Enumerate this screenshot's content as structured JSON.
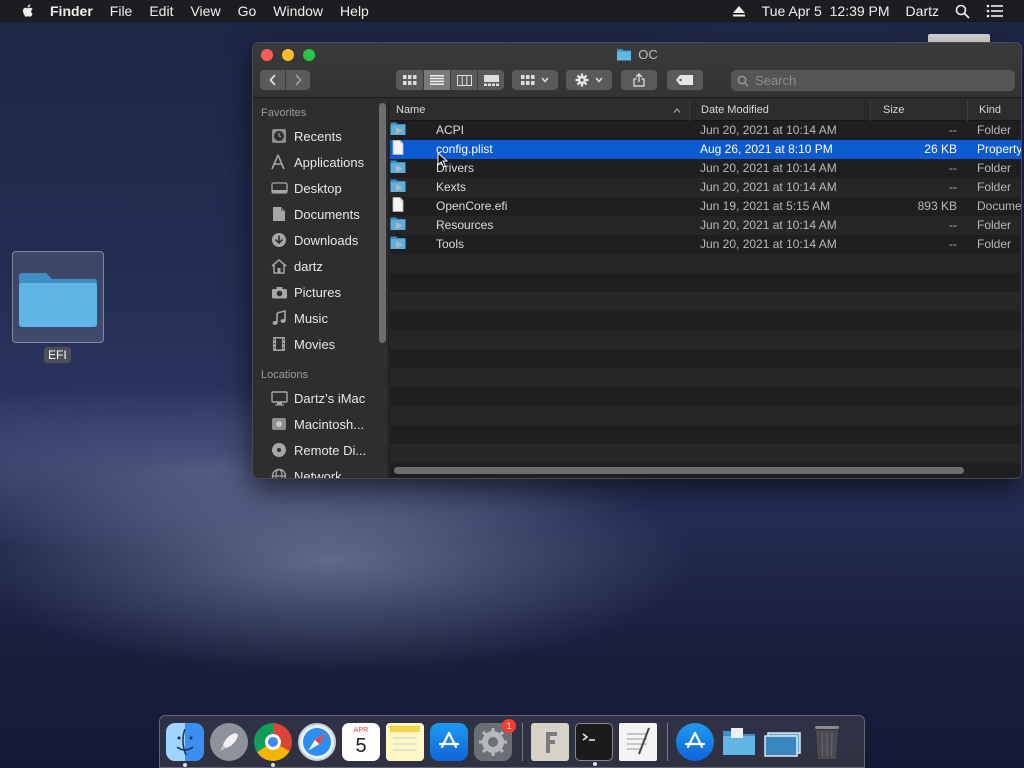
{
  "menubar": {
    "app_name": "Finder",
    "menus": [
      "File",
      "Edit",
      "View",
      "Go",
      "Window",
      "Help"
    ],
    "clock": "Tue Apr 5  12:39 PM",
    "user": "Dartz"
  },
  "desktop": {
    "efi_label": "EFI"
  },
  "window": {
    "title": "OC",
    "search_placeholder": "Search",
    "sidebar": {
      "favorites_heading": "Favorites",
      "favorites": [
        {
          "label": "Recents",
          "icon": "clock-icon"
        },
        {
          "label": "Applications",
          "icon": "applications-icon"
        },
        {
          "label": "Desktop",
          "icon": "desktop-icon"
        },
        {
          "label": "Documents",
          "icon": "documents-icon"
        },
        {
          "label": "Downloads",
          "icon": "downloads-icon"
        },
        {
          "label": "dartz",
          "icon": "home-icon"
        },
        {
          "label": "Pictures",
          "icon": "camera-icon"
        },
        {
          "label": "Music",
          "icon": "music-icon"
        },
        {
          "label": "Movies",
          "icon": "film-icon"
        }
      ],
      "locations_heading": "Locations",
      "locations": [
        {
          "label": "Dartz’s iMac",
          "icon": "imac-icon"
        },
        {
          "label": "Macintosh...",
          "icon": "disk-icon"
        },
        {
          "label": "Remote Di...",
          "icon": "remote-disc-icon"
        },
        {
          "label": "Network",
          "icon": "network-icon"
        }
      ]
    },
    "columns": {
      "name": "Name",
      "date": "Date Modified",
      "size": "Size",
      "kind": "Kind"
    },
    "files": [
      {
        "name": "ACPI",
        "date": "Jun 20, 2021 at 10:14 AM",
        "size": "--",
        "kind": "Folder",
        "type": "folder",
        "selected": false
      },
      {
        "name": "config.plist",
        "date": "Aug 26, 2021 at 8:10 PM",
        "size": "26 KB",
        "kind": "Property",
        "type": "file",
        "selected": true
      },
      {
        "name": "Drivers",
        "date": "Jun 20, 2021 at 10:14 AM",
        "size": "--",
        "kind": "Folder",
        "type": "folder",
        "selected": false
      },
      {
        "name": "Kexts",
        "date": "Jun 20, 2021 at 10:14 AM",
        "size": "--",
        "kind": "Folder",
        "type": "folder",
        "selected": false
      },
      {
        "name": "OpenCore.efi",
        "date": "Jun 19, 2021 at 5:15 AM",
        "size": "893 KB",
        "kind": "Docume",
        "type": "file",
        "selected": false
      },
      {
        "name": "Resources",
        "date": "Jun 20, 2021 at 10:14 AM",
        "size": "--",
        "kind": "Folder",
        "type": "folder",
        "selected": false
      },
      {
        "name": "Tools",
        "date": "Jun 20, 2021 at 10:14 AM",
        "size": "--",
        "kind": "Folder",
        "type": "folder",
        "selected": false
      }
    ]
  },
  "dock": {
    "calendar_month": "APR",
    "calendar_day": "5",
    "settings_badge": "1"
  },
  "colors": {
    "selection": "#0b5acf",
    "folder": "#5aaee0"
  }
}
